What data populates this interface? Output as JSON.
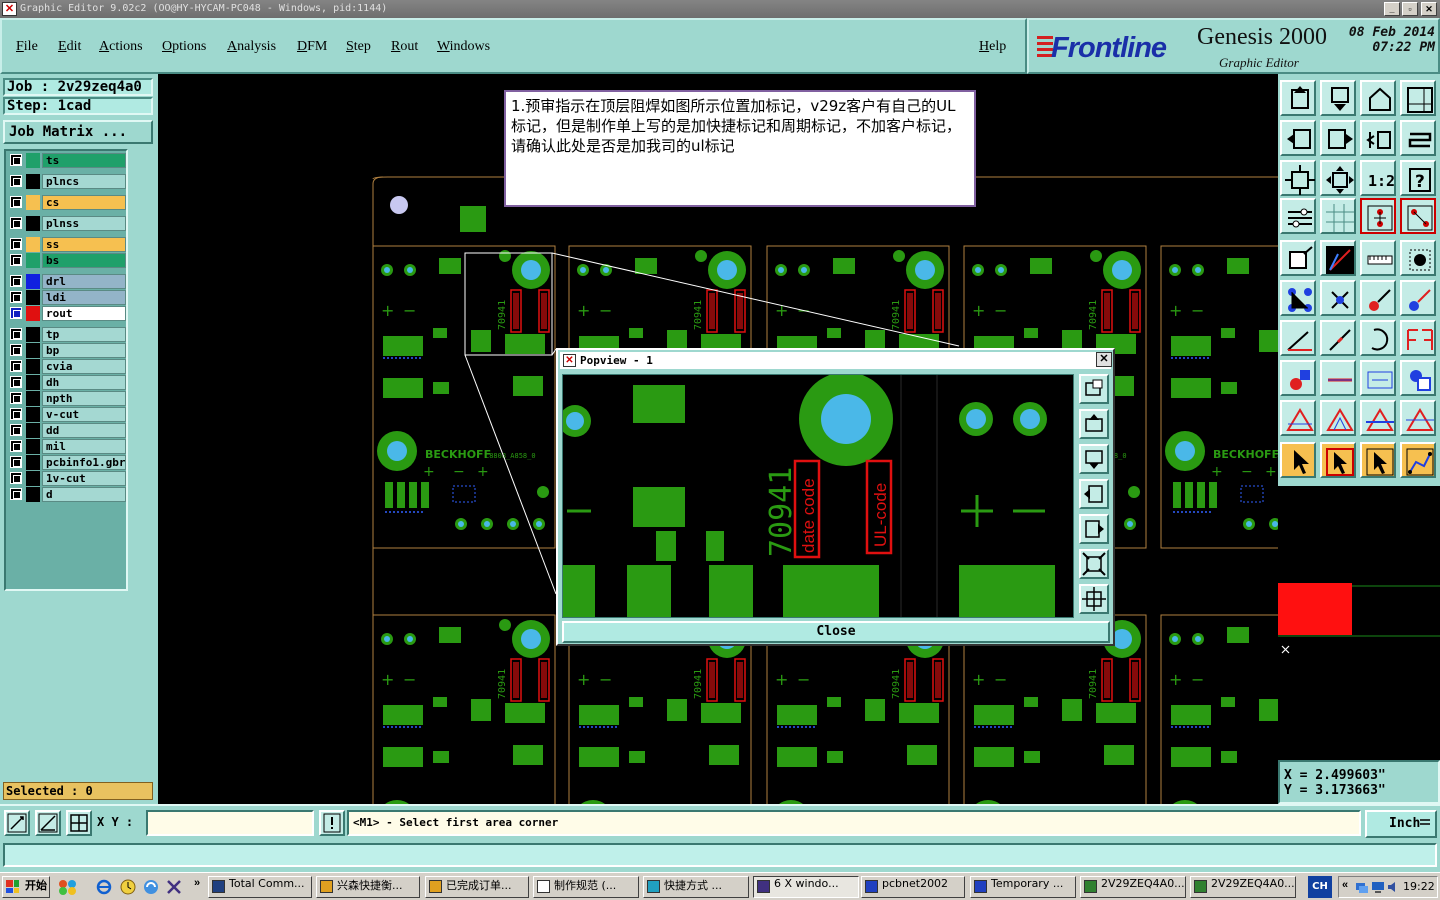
{
  "window": {
    "title": "Graphic Editor 9.02c2 (OO@HY-HYCAM-PC048 - Windows, pid:1144)",
    "icon_name": "app-icon"
  },
  "menu": {
    "items": [
      "File",
      "Edit",
      "Actions",
      "Options",
      "Analysis",
      "DFM",
      "Step",
      "Rout",
      "Windows"
    ],
    "help": "Help"
  },
  "logo": {
    "brand": "Frontline",
    "product": "Genesis 2000",
    "subtitle": "Graphic Editor",
    "date": "08 Feb 2014",
    "time": "07:22 PM"
  },
  "job": {
    "job": "Job : 2v29zeq4a0",
    "step": "Step: 1cad",
    "matrix_button": "Job Matrix ..."
  },
  "layers": [
    {
      "name": "ts",
      "color": "#1fa06a",
      "hl": "#1fa06a"
    },
    {
      "name": "plncs",
      "color": "#000000",
      "hl": ""
    },
    {
      "name": "cs",
      "color": "#f6c050",
      "hl": "#f6c050"
    },
    {
      "name": "plnss",
      "color": "#000000",
      "hl": ""
    },
    {
      "name": "ss",
      "color": "#f6c050",
      "hl": "#f6c050"
    },
    {
      "name": "bs",
      "color": "#1fa06a",
      "hl": "#1fa06a"
    },
    {
      "name": "drl",
      "color": "#1020e0",
      "hl": "#93b4c8"
    },
    {
      "name": "ldi",
      "color": "#000000",
      "hl": "#93b4c8"
    },
    {
      "name": "rout",
      "color": "#e01010",
      "hl": "#ffffff"
    },
    {
      "name": "tp",
      "color": "#000000",
      "hl": ""
    },
    {
      "name": "bp",
      "color": "#000000",
      "hl": ""
    },
    {
      "name": "cvia",
      "color": "#000000",
      "hl": ""
    },
    {
      "name": "dh",
      "color": "#000000",
      "hl": ""
    },
    {
      "name": "npth",
      "color": "#000000",
      "hl": ""
    },
    {
      "name": "v-cut",
      "color": "#000000",
      "hl": ""
    },
    {
      "name": "dd",
      "color": "#000000",
      "hl": ""
    },
    {
      "name": "mil",
      "color": "#000000",
      "hl": ""
    },
    {
      "name": "pcbinfo1.gbr",
      "color": "#000000",
      "hl": ""
    },
    {
      "name": "1v-cut",
      "color": "#000000",
      "hl": ""
    },
    {
      "name": "d",
      "color": "#000000",
      "hl": ""
    }
  ],
  "selected": "Selected : 0",
  "note": "1.预审指示在顶层阻焊如图所示位置加标记，v29z客户有自己的UL标记，但是制作单上写的是加快捷标记和周期标记，不加客户标记，请确认此处是否是加我司的ul标记",
  "board": {
    "part_number": "70941",
    "date_code": "date code",
    "ul_code": "UL-code",
    "brand_text": "BECKHOFF",
    "brand_suffix": "C8808_A858_0",
    "plus": "+",
    "minus": "−"
  },
  "popview": {
    "title": "Popview - 1",
    "close": "Close"
  },
  "coords": {
    "x": "X = 2.499603\"",
    "y": "Y = 3.173663\""
  },
  "command": {
    "xy_label": "X Y :",
    "xy_value": "",
    "message": "<M1> - Select first area corner",
    "unit": "Inch"
  },
  "taskbar": {
    "start": "开始",
    "tasks": [
      "Total Comm...",
      "兴森快捷衡...",
      "已完成订单...",
      "制作规范 (...",
      "快捷方式 ...",
      "6 X windo...",
      "pcbnet2002",
      "Temporary ...",
      "2V29ZEQ4A0...",
      "2V29ZEQ4A0..."
    ],
    "lang": "CH",
    "clock": "19:22"
  },
  "colors": {
    "panel": "#9ed8cf",
    "copper": "#2a9a12",
    "pad_hole": "#4ab8e8",
    "silk_red": "#e01010"
  }
}
